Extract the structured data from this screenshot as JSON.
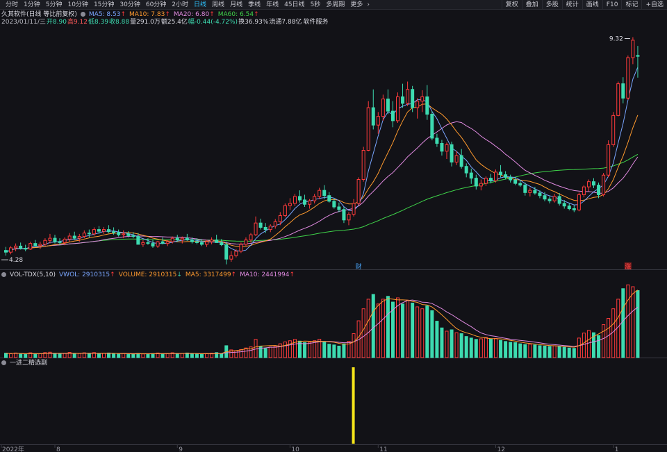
{
  "toolbar": {
    "periods": [
      "分时",
      "1分钟",
      "5分钟",
      "10分钟",
      "15分钟",
      "30分钟",
      "60分钟",
      "2小时",
      "日线",
      "周线",
      "月线",
      "季线",
      "年线",
      "45日线",
      "5秒",
      "多周期",
      "更多"
    ],
    "active_period": "日线",
    "more_icon": "chevron-right-icon",
    "tools": [
      "复权",
      "叠加",
      "多股",
      "统计",
      "画线",
      "F10",
      "标记",
      "+自选"
    ]
  },
  "colors": {
    "up": "#ff3b3b",
    "down": "#3ddbb0",
    "ma5": "#7aa6ff",
    "ma10": "#ff9a2e",
    "ma20": "#e08ae0",
    "ma60": "#3fd44a",
    "signal": "#f5e51a",
    "vwol": "#7aa6ff",
    "volume": "#ff9a2e",
    "vol_ma5": "#ff9a2e",
    "vol_ma10": "#e08ae0"
  },
  "main_legend": {
    "title": "久其软件(日线 等比前复权)",
    "ma5": "MA5: 8.53",
    "ma10": "MA10: 7.83",
    "ma20": "MA20: 6.80",
    "ma60": "MA60: 6.54",
    "arrow_up": "↑"
  },
  "info_line": {
    "date": "2023/01/11/三",
    "open": "开8.90",
    "high": "高9.12",
    "low": "低8.39",
    "close": "收8.88",
    "volume": "量291.0万",
    "amount": "额25.4亿",
    "change": "幅-0.44(-4.72%)",
    "turnover": "换36.93%",
    "float_cap": "流通7.88亿",
    "sector": "软件服务"
  },
  "vol_legend": {
    "name": "VOL-TDX(5,10)",
    "vwol": "VWOL: 2910315",
    "volume": "VOLUME: 2910315",
    "ma5": "MA5: 3317499",
    "ma10": "MA10: 2441994",
    "arrow_up": "↑",
    "arrow_down": "↓"
  },
  "signal_legend": {
    "name": "一进二精选副"
  },
  "markers": {
    "high_label": "9.32",
    "low_label": "4.28",
    "finance_badge": "财",
    "limit_up_badge": "涨"
  },
  "chart_data": {
    "type": "candlestick",
    "period": "daily",
    "x_tick_labels": [
      "2022年",
      "8",
      "9",
      "10",
      "11",
      "12",
      "1"
    ],
    "y_range": [
      4.0,
      9.6
    ],
    "candles": [
      [
        4.42,
        4.5,
        4.3,
        4.38
      ],
      [
        4.38,
        4.52,
        4.33,
        4.48
      ],
      [
        4.48,
        4.58,
        4.4,
        4.52
      ],
      [
        4.52,
        4.6,
        4.44,
        4.47
      ],
      [
        4.47,
        4.55,
        4.4,
        4.45
      ],
      [
        4.45,
        4.62,
        4.43,
        4.58
      ],
      [
        4.58,
        4.66,
        4.5,
        4.53
      ],
      [
        4.53,
        4.62,
        4.45,
        4.56
      ],
      [
        4.56,
        4.7,
        4.52,
        4.65
      ],
      [
        4.65,
        4.8,
        4.58,
        4.7
      ],
      [
        4.7,
        4.78,
        4.58,
        4.62
      ],
      [
        4.62,
        4.7,
        4.55,
        4.6
      ],
      [
        4.6,
        4.72,
        4.54,
        4.68
      ],
      [
        4.68,
        4.82,
        4.62,
        4.75
      ],
      [
        4.75,
        4.85,
        4.66,
        4.7
      ],
      [
        4.7,
        4.8,
        4.62,
        4.74
      ],
      [
        4.74,
        4.88,
        4.7,
        4.82
      ],
      [
        4.82,
        4.9,
        4.72,
        4.8
      ],
      [
        4.8,
        4.95,
        4.76,
        4.9
      ],
      [
        4.9,
        4.98,
        4.8,
        4.86
      ],
      [
        4.86,
        4.96,
        4.8,
        4.9
      ],
      [
        4.9,
        5.0,
        4.82,
        4.85
      ],
      [
        4.85,
        4.95,
        4.78,
        4.83
      ],
      [
        4.83,
        4.9,
        4.74,
        4.78
      ],
      [
        4.78,
        4.88,
        4.7,
        4.8
      ],
      [
        4.8,
        4.86,
        4.72,
        4.76
      ],
      [
        4.76,
        4.84,
        4.7,
        4.74
      ],
      [
        4.74,
        4.82,
        4.62,
        4.56
      ],
      [
        4.56,
        4.66,
        4.5,
        4.6
      ],
      [
        4.6,
        4.7,
        4.55,
        4.58
      ],
      [
        4.58,
        4.66,
        4.48,
        4.52
      ],
      [
        4.52,
        4.64,
        4.48,
        4.62
      ],
      [
        4.62,
        4.72,
        4.56,
        4.58
      ],
      [
        4.58,
        4.66,
        4.52,
        4.62
      ],
      [
        4.62,
        4.74,
        4.58,
        4.7
      ],
      [
        4.7,
        4.78,
        4.62,
        4.66
      ],
      [
        4.66,
        4.74,
        4.58,
        4.7
      ],
      [
        4.7,
        4.8,
        4.64,
        4.66
      ],
      [
        4.66,
        4.72,
        4.58,
        4.62
      ],
      [
        4.62,
        4.7,
        4.56,
        4.6
      ],
      [
        4.6,
        4.68,
        4.52,
        4.56
      ],
      [
        4.56,
        4.66,
        4.5,
        4.62
      ],
      [
        4.62,
        4.72,
        4.56,
        4.66
      ],
      [
        4.66,
        4.78,
        4.6,
        4.6
      ],
      [
        4.6,
        4.68,
        4.52,
        4.55
      ],
      [
        4.55,
        4.62,
        4.1,
        4.22
      ],
      [
        4.22,
        4.4,
        4.16,
        4.3
      ],
      [
        4.3,
        4.45,
        4.26,
        4.4
      ],
      [
        4.4,
        4.6,
        4.36,
        4.56
      ],
      [
        4.56,
        4.72,
        4.52,
        4.66
      ],
      [
        4.66,
        4.82,
        4.6,
        4.78
      ],
      [
        4.78,
        5.2,
        4.75,
        5.05
      ],
      [
        5.05,
        5.15,
        4.9,
        4.95
      ],
      [
        4.95,
        5.05,
        4.82,
        4.9
      ],
      [
        4.9,
        5.02,
        4.84,
        4.98
      ],
      [
        4.98,
        5.14,
        4.92,
        5.08
      ],
      [
        5.08,
        5.3,
        5.0,
        5.22
      ],
      [
        5.22,
        5.5,
        5.18,
        5.45
      ],
      [
        5.45,
        5.62,
        5.35,
        5.5
      ],
      [
        5.5,
        5.72,
        5.44,
        5.66
      ],
      [
        5.66,
        5.8,
        5.52,
        5.58
      ],
      [
        5.58,
        5.7,
        5.42,
        5.48
      ],
      [
        5.48,
        5.6,
        5.38,
        5.56
      ],
      [
        5.56,
        5.72,
        5.5,
        5.66
      ],
      [
        5.66,
        5.86,
        5.6,
        5.8
      ],
      [
        5.8,
        5.92,
        5.6,
        5.68
      ],
      [
        5.68,
        5.76,
        5.52,
        5.55
      ],
      [
        5.55,
        5.62,
        5.38,
        5.42
      ],
      [
        5.42,
        5.52,
        5.3,
        5.36
      ],
      [
        5.36,
        5.42,
        5.05,
        5.12
      ],
      [
        5.12,
        5.3,
        5.0,
        5.25
      ],
      [
        5.25,
        5.6,
        5.2,
        5.5
      ],
      [
        5.5,
        6.1,
        5.45,
        6.05
      ],
      [
        6.05,
        6.8,
        6.0,
        6.72
      ],
      [
        6.72,
        7.85,
        6.7,
        7.7
      ],
      [
        7.7,
        8.12,
        7.2,
        7.3
      ],
      [
        7.3,
        7.6,
        7.1,
        7.5
      ],
      [
        7.5,
        8.0,
        7.4,
        7.9
      ],
      [
        7.9,
        8.12,
        7.55,
        7.62
      ],
      [
        7.62,
        7.85,
        7.25,
        7.4
      ],
      [
        7.4,
        8.05,
        7.35,
        7.95
      ],
      [
        7.95,
        8.25,
        7.7,
        7.8
      ],
      [
        7.8,
        8.3,
        7.74,
        8.12
      ],
      [
        8.12,
        8.2,
        7.6,
        7.7
      ],
      [
        7.7,
        7.92,
        7.45,
        7.85
      ],
      [
        7.85,
        8.1,
        7.6,
        7.95
      ],
      [
        7.95,
        8.22,
        7.42,
        7.55
      ],
      [
        7.55,
        7.62,
        6.95,
        7.0
      ],
      [
        7.0,
        7.1,
        6.8,
        6.88
      ],
      [
        6.88,
        6.96,
        6.6,
        6.7
      ],
      [
        6.7,
        6.9,
        6.52,
        6.85
      ],
      [
        6.85,
        6.92,
        6.35,
        6.45
      ],
      [
        6.45,
        6.7,
        6.38,
        6.6
      ],
      [
        6.6,
        6.75,
        6.3,
        6.35
      ],
      [
        6.35,
        6.42,
        6.1,
        6.2
      ],
      [
        6.2,
        6.3,
        5.95,
        6.08
      ],
      [
        6.08,
        6.16,
        5.82,
        5.9
      ],
      [
        5.9,
        6.05,
        5.8,
        5.96
      ],
      [
        5.96,
        6.12,
        5.9,
        6.08
      ],
      [
        6.08,
        6.18,
        5.96,
        6.02
      ],
      [
        6.02,
        6.28,
        5.98,
        6.22
      ],
      [
        6.22,
        6.38,
        6.1,
        6.16
      ],
      [
        6.16,
        6.24,
        6.05,
        6.1
      ],
      [
        6.1,
        6.16,
        5.98,
        6.04
      ],
      [
        6.04,
        6.1,
        5.92,
        5.96
      ],
      [
        5.96,
        6.04,
        5.88,
        5.92
      ],
      [
        5.92,
        5.98,
        5.68,
        5.75
      ],
      [
        5.75,
        5.86,
        5.66,
        5.8
      ],
      [
        5.8,
        5.88,
        5.7,
        5.74
      ],
      [
        5.74,
        5.8,
        5.62,
        5.68
      ],
      [
        5.68,
        5.76,
        5.55,
        5.6
      ],
      [
        5.6,
        5.66,
        5.5,
        5.56
      ],
      [
        5.56,
        5.72,
        5.52,
        5.66
      ],
      [
        5.66,
        5.74,
        5.45,
        5.5
      ],
      [
        5.5,
        5.58,
        5.38,
        5.44
      ],
      [
        5.44,
        5.5,
        5.34,
        5.38
      ],
      [
        5.38,
        5.46,
        5.3,
        5.35
      ],
      [
        5.35,
        5.75,
        5.32,
        5.7
      ],
      [
        5.7,
        5.92,
        5.64,
        5.88
      ],
      [
        5.88,
        6.05,
        5.78,
        6.0
      ],
      [
        6.0,
        6.08,
        5.85,
        5.92
      ],
      [
        5.92,
        5.98,
        5.62,
        5.7
      ],
      [
        5.7,
        6.2,
        5.66,
        6.15
      ],
      [
        6.15,
        6.95,
        6.1,
        6.85
      ],
      [
        6.85,
        7.6,
        6.8,
        7.52
      ],
      [
        7.52,
        8.3,
        7.5,
        8.25
      ],
      [
        8.25,
        8.4,
        7.8,
        7.92
      ],
      [
        7.92,
        8.9,
        7.88,
        8.85
      ],
      [
        8.85,
        9.32,
        8.7,
        9.25
      ],
      [
        8.9,
        9.12,
        8.39,
        8.88
      ]
    ],
    "volume": [
      0.23,
      0.2,
      0.24,
      0.18,
      0.17,
      0.25,
      0.19,
      0.2,
      0.26,
      0.28,
      0.21,
      0.18,
      0.22,
      0.27,
      0.2,
      0.21,
      0.25,
      0.19,
      0.26,
      0.2,
      0.22,
      0.24,
      0.19,
      0.18,
      0.22,
      0.19,
      0.18,
      0.22,
      0.19,
      0.2,
      0.21,
      0.24,
      0.19,
      0.21,
      0.25,
      0.2,
      0.22,
      0.24,
      0.19,
      0.18,
      0.17,
      0.21,
      0.23,
      0.26,
      0.2,
      0.62,
      0.4,
      0.36,
      0.42,
      0.5,
      0.56,
      0.95,
      0.58,
      0.48,
      0.55,
      0.6,
      0.72,
      0.82,
      0.88,
      0.95,
      0.86,
      0.78,
      0.8,
      0.88,
      0.96,
      0.8,
      0.7,
      0.66,
      0.6,
      0.72,
      0.85,
      1.25,
      1.92,
      2.55,
      3.05,
      3.3,
      2.8,
      3.05,
      3.2,
      2.9,
      3.12,
      2.8,
      3.0,
      2.85,
      2.65,
      2.55,
      2.7,
      2.45,
      1.9,
      1.55,
      1.38,
      1.45,
      1.3,
      1.25,
      1.1,
      1.02,
      0.95,
      0.98,
      1.05,
      0.96,
      1.0,
      0.9,
      0.84,
      0.8,
      0.78,
      0.72,
      0.68,
      0.7,
      0.66,
      0.62,
      0.6,
      0.58,
      0.62,
      0.57,
      0.54,
      0.5,
      0.48,
      1.02,
      1.28,
      1.42,
      1.3,
      1.15,
      1.72,
      2.05,
      2.55,
      3.05,
      3.6,
      3.8,
      3.7,
      3.5
    ],
    "ma_series": [
      "MA5",
      "MA10",
      "MA20",
      "MA60"
    ],
    "signal": {
      "name": "一进二精选副",
      "bar_index": 71,
      "value": 1
    }
  }
}
